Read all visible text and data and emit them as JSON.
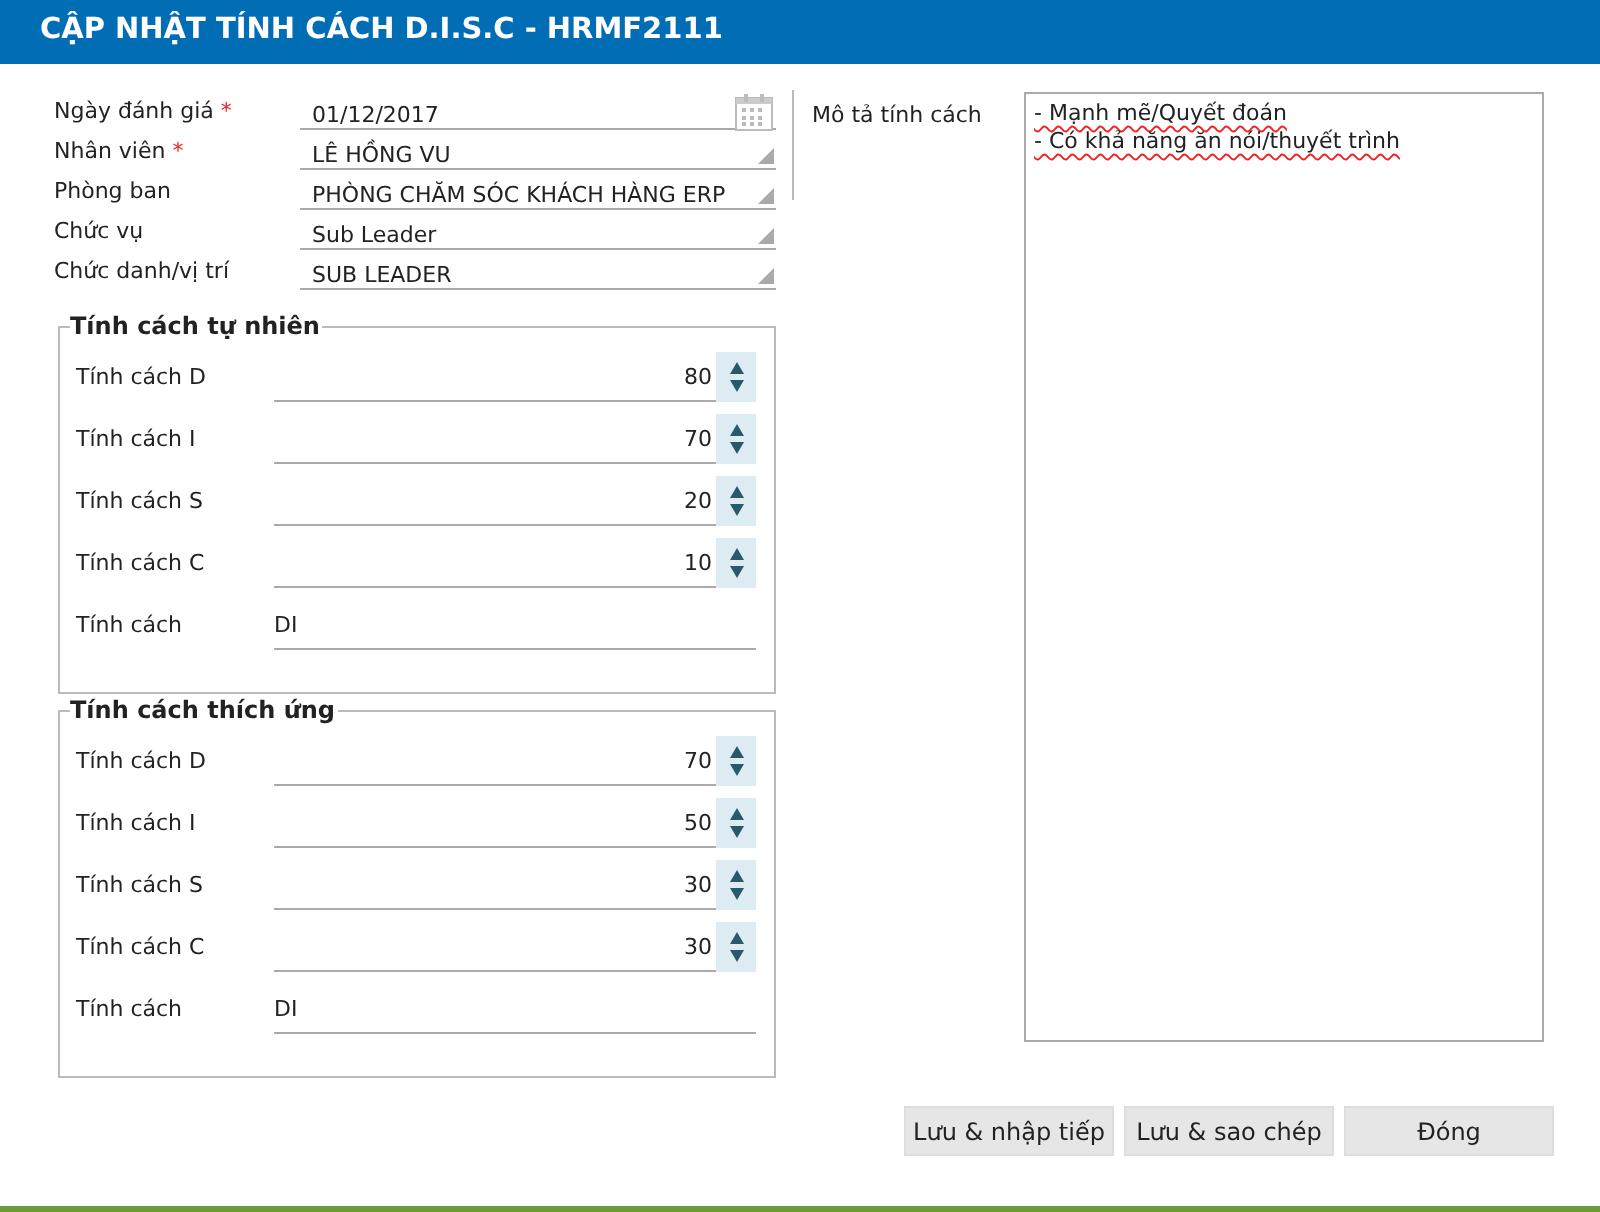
{
  "window": {
    "title": "CẬP NHẬT TÍNH CÁCH D.I.S.C - HRMF2111"
  },
  "fields": [
    {
      "label": "Ngày đánh giá",
      "required_mark": "*",
      "value": "01/12/2017",
      "kind": "date"
    },
    {
      "label": "Nhân viên",
      "required_mark": "*",
      "value": "LÊ HỒNG VU",
      "kind": "select"
    },
    {
      "label": "Phòng ban",
      "value": "PHÒNG CHĂM SÓC KHÁCH HÀNG ERP",
      "kind": "select"
    },
    {
      "label": "Chức vụ",
      "value": "Sub Leader",
      "kind": "select"
    },
    {
      "label": "Chức danh/vị trí",
      "value": "SUB LEADER",
      "kind": "select"
    }
  ],
  "groups": [
    {
      "title": "Tính cách tự nhiên",
      "rows": [
        {
          "label": "Tính cách D",
          "value": "80",
          "kind": "spin"
        },
        {
          "label": "Tính cách I",
          "value": "70",
          "kind": "spin"
        },
        {
          "label": "Tính cách S",
          "value": "20",
          "kind": "spin"
        },
        {
          "label": "Tính cách C",
          "value": "10",
          "kind": "spin"
        },
        {
          "label": "Tính cách",
          "value": "DI",
          "kind": "text"
        }
      ]
    },
    {
      "title": "Tính cách thích ứng",
      "rows": [
        {
          "label": "Tính cách D",
          "value": "70",
          "kind": "spin"
        },
        {
          "label": "Tính cách I",
          "value": "50",
          "kind": "spin"
        },
        {
          "label": "Tính cách S",
          "value": "30",
          "kind": "spin"
        },
        {
          "label": "Tính cách C",
          "value": "30",
          "kind": "spin"
        },
        {
          "label": "Tính cách",
          "value": "DI",
          "kind": "text"
        }
      ]
    }
  ],
  "description": {
    "label": "Mô tả tính cách",
    "value": "- Mạnh mẽ/Quyết đoán\n- Có khả năng ăn nói/thuyết trình",
    "spellcheck_marked": true
  },
  "buttons": [
    "Lưu & nhập tiếp",
    "Lưu & sao chép",
    "Đóng"
  ]
}
